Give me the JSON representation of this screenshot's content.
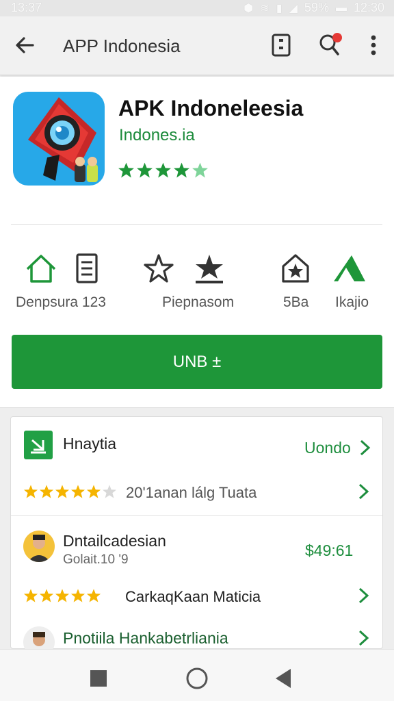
{
  "status_bar": {
    "time_left": "13:37",
    "battery": "59%",
    "time_right": "12:30"
  },
  "app_bar": {
    "title": "APP Indonesia"
  },
  "app": {
    "name": "APK Indoneleesia",
    "developer": "Indones.ia",
    "rating_stars": 4.5
  },
  "features": [
    {
      "label": "Denpsura 123",
      "icon": "home-icon"
    },
    {
      "label": "Piepnasom",
      "icon": "star-outline-icon"
    },
    {
      "label": "5Ba",
      "icon": "mail-star-icon"
    },
    {
      "label": "Ikajio",
      "icon": "play-triangle-icon"
    }
  ],
  "install_button": {
    "label": "UNB ±"
  },
  "reviews_card": {
    "section_title": "Hnaytia",
    "section_link": "Uondo",
    "summary_text": "20'1anan lálg Tuata",
    "summary_rating": 4.5,
    "review": {
      "name": "Dntailcadesian",
      "sub": "Golait.10 '9",
      "price": "$49:61",
      "rating": 5,
      "text": "CarkaqKaan Maticia"
    },
    "next_review": {
      "name": "Pnotiila Hankabetrliania"
    }
  },
  "colors": {
    "accent_green": "#1e9639",
    "star_green": "#1e9639",
    "star_yellow": "#f5b400",
    "icon_blue": "#27a8e8"
  }
}
